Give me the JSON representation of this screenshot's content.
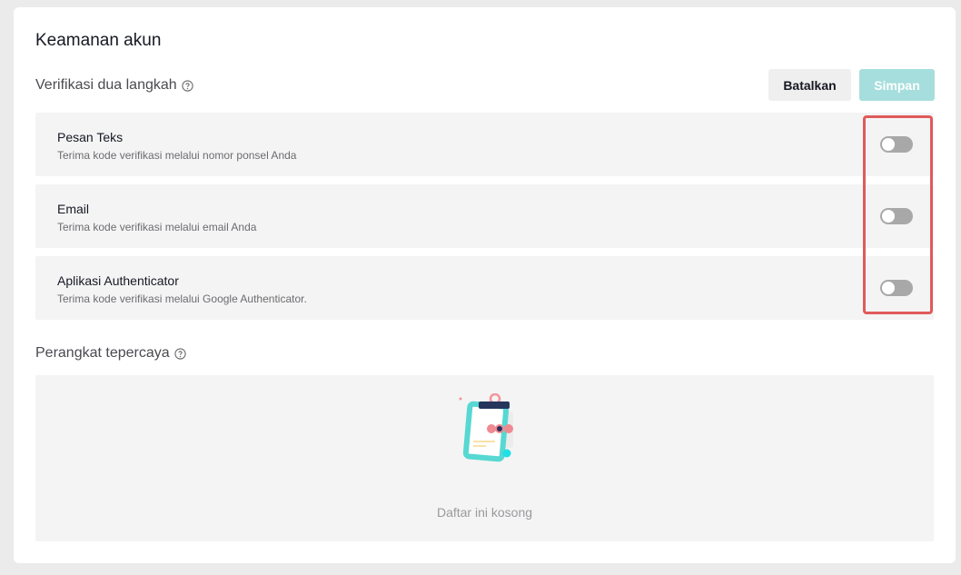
{
  "page": {
    "title": "Keamanan akun"
  },
  "two_step": {
    "heading": "Verifikasi dua langkah",
    "cancel_label": "Batalkan",
    "save_label": "Simpan",
    "options": [
      {
        "title": "Pesan Teks",
        "description": "Terima kode verifikasi melalui nomor ponsel Anda",
        "enabled": false
      },
      {
        "title": "Email",
        "description": "Terima kode verifikasi melalui email Anda",
        "enabled": false
      },
      {
        "title": "Aplikasi Authenticator",
        "description": "Terima kode verifikasi melalui Google Authenticator.",
        "enabled": false
      }
    ]
  },
  "trusted_devices": {
    "heading": "Perangkat tepercaya",
    "empty_text": "Daftar ini kosong"
  },
  "icons": {
    "help": "question-circle-icon",
    "empty": "empty-clipboard-illustration"
  },
  "colors": {
    "accent_disabled": "#a6dedd",
    "toggle_off": "#a8a8a8",
    "highlight": "#e05a5a"
  }
}
